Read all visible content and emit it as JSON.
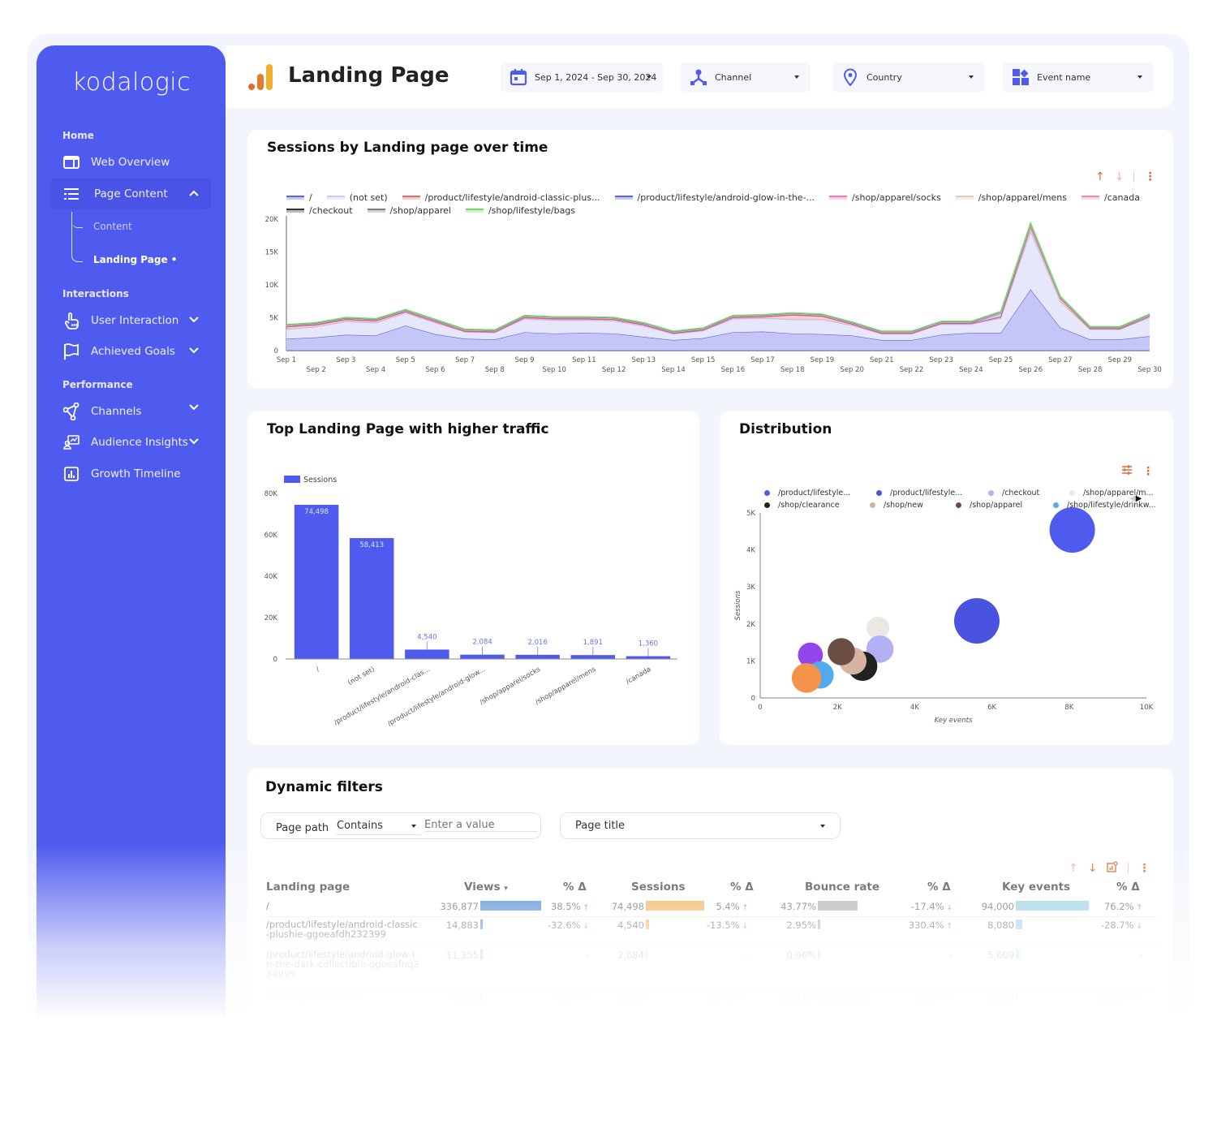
{
  "sidebar": {
    "logo": "kodalogic",
    "sections": [
      {
        "label": "Home"
      },
      {
        "label": "Interactions"
      },
      {
        "label": "Performance"
      }
    ],
    "items": [
      {
        "label": "Web Overview",
        "icon": "browser-window-icon"
      },
      {
        "label": "Page Content",
        "icon": "list-icon",
        "expanded": true
      },
      {
        "label": "User Interaction",
        "icon": "hand-pointer-icon"
      },
      {
        "label": "Achieved Goals",
        "icon": "flag-icon"
      },
      {
        "label": "Channels",
        "icon": "share-nodes-icon"
      },
      {
        "label": "Audience Insights",
        "icon": "audience-icon"
      },
      {
        "label": "Growth Timeline",
        "icon": "bar-chart-icon"
      }
    ],
    "subitems": [
      {
        "label": "Content"
      },
      {
        "label": "Landing Page •",
        "current": true
      }
    ]
  },
  "header": {
    "title": "Landing Page",
    "filters": [
      {
        "label": "Sep 1, 2024 - Sep 30, 2024",
        "icon": "calendar-icon"
      },
      {
        "label": "Channel",
        "icon": "channel-icon"
      },
      {
        "label": "Country",
        "icon": "location-pin-icon"
      },
      {
        "label": "Event name",
        "icon": "widgets-icon"
      }
    ]
  },
  "colors": {
    "brand": "#4f5bef",
    "accent_orange": "#d96b35",
    "bar": "#4f5bef",
    "views_bar": "#3d7ecb",
    "sessions_bar": "#f2a94a",
    "bounce_bar": "#a9a9a9",
    "key_events_bar": "#8fcbe0"
  },
  "chart_data": [
    {
      "type": "area",
      "title": "Sessions by Landing page over time",
      "stacked": true,
      "xlabel": "",
      "ylabel": "",
      "ylim": [
        0,
        20000
      ],
      "yticks": [
        "0",
        "5K",
        "10K",
        "15K",
        "20K"
      ],
      "x": [
        "Sep 1",
        "Sep 2",
        "Sep 3",
        "Sep 4",
        "Sep 5",
        "Sep 6",
        "Sep 7",
        "Sep 8",
        "Sep 9",
        "Sep 10",
        "Sep 11",
        "Sep 12",
        "Sep 13",
        "Sep 14",
        "Sep 15",
        "Sep 16",
        "Sep 17",
        "Sep 18",
        "Sep 19",
        "Sep 20",
        "Sep 21",
        "Sep 22",
        "Sep 23",
        "Sep 24",
        "Sep 25",
        "Sep 26",
        "Sep 27",
        "Sep 28",
        "Sep 29",
        "Sep 30"
      ],
      "legend_position": "top",
      "series": [
        {
          "name": "/",
          "color": "#5b63e8",
          "values": [
            1800,
            2000,
            2400,
            2300,
            3800,
            2500,
            1800,
            1700,
            2800,
            2600,
            2700,
            2600,
            2100,
            1600,
            1900,
            2800,
            2900,
            2600,
            2500,
            2300,
            1600,
            1600,
            2400,
            2700,
            2700,
            9300,
            3500,
            1700,
            1700,
            2200
          ]
        },
        {
          "name": "(not set)",
          "color": "#c8cbf7",
          "values": [
            1400,
            1600,
            2000,
            1900,
            1900,
            1700,
            1000,
            1000,
            2000,
            2000,
            1900,
            1900,
            1600,
            900,
            1100,
            2000,
            2000,
            2100,
            2200,
            1500,
            900,
            900,
            1600,
            1300,
            2200,
            8800,
            3900,
            1500,
            1500,
            2800
          ]
        },
        {
          "name": "/product/lifestyle/android-classic-plus...",
          "color": "#ee6b6b",
          "values": [
            400,
            300,
            300,
            300,
            200,
            200,
            100,
            100,
            200,
            200,
            200,
            200,
            200,
            100,
            100,
            200,
            200,
            700,
            500,
            200,
            100,
            100,
            100,
            100,
            200,
            700,
            500,
            100,
            100,
            200
          ]
        },
        {
          "name": "/product/lifestyle/android-glow-in-the-...",
          "color": "#5b63e8",
          "values": [
            100,
            100,
            100,
            100,
            100,
            100,
            100,
            100,
            100,
            100,
            100,
            100,
            100,
            100,
            100,
            100,
            100,
            100,
            100,
            100,
            100,
            100,
            100,
            100,
            600,
            100,
            100,
            100,
            100,
            100
          ]
        },
        {
          "name": "/shop/apparel/socks",
          "color": "#f07ac0",
          "values": [
            50,
            50,
            50,
            50,
            50,
            50,
            50,
            50,
            50,
            50,
            50,
            50,
            50,
            50,
            50,
            50,
            50,
            50,
            50,
            50,
            50,
            50,
            50,
            50,
            50,
            100,
            50,
            50,
            50,
            50
          ]
        },
        {
          "name": "/shop/apparel/mens",
          "color": "#e8c8b8",
          "values": [
            50,
            50,
            50,
            50,
            50,
            50,
            50,
            50,
            50,
            50,
            50,
            50,
            50,
            50,
            50,
            50,
            50,
            50,
            50,
            50,
            50,
            50,
            50,
            50,
            50,
            100,
            50,
            50,
            50,
            50
          ]
        },
        {
          "name": "/canada",
          "color": "#f08cab",
          "values": [
            50,
            50,
            50,
            50,
            50,
            50,
            50,
            50,
            50,
            50,
            50,
            50,
            50,
            50,
            50,
            50,
            50,
            50,
            50,
            50,
            50,
            50,
            50,
            50,
            50,
            100,
            50,
            50,
            50,
            50
          ]
        },
        {
          "name": "/checkout",
          "color": "#333333",
          "values": [
            50,
            50,
            50,
            50,
            50,
            50,
            50,
            50,
            50,
            50,
            50,
            50,
            50,
            50,
            50,
            50,
            50,
            50,
            50,
            50,
            50,
            50,
            50,
            50,
            50,
            100,
            50,
            50,
            50,
            50
          ]
        },
        {
          "name": "/shop/apparel",
          "color": "#8a7a75",
          "values": [
            20,
            20,
            20,
            20,
            20,
            20,
            20,
            20,
            20,
            20,
            20,
            20,
            20,
            20,
            20,
            20,
            20,
            20,
            20,
            20,
            20,
            20,
            20,
            20,
            20,
            50,
            20,
            20,
            20,
            20
          ]
        },
        {
          "name": "/shop/lifestyle/bags",
          "color": "#6fdd6f",
          "values": [
            30,
            30,
            30,
            30,
            30,
            30,
            30,
            30,
            30,
            30,
            30,
            30,
            30,
            30,
            30,
            30,
            30,
            30,
            30,
            30,
            30,
            30,
            30,
            30,
            30,
            50,
            30,
            30,
            30,
            30
          ]
        }
      ]
    },
    {
      "type": "bar",
      "title": "Top Landing Page with higher traffic",
      "categories": [
        "/",
        "(not set)",
        "/product/lifestyle/android-clas...",
        "/product/lifestyle/android-glow...",
        "/shop/apparel/socks",
        "/shop/apparel/mens",
        "/canada"
      ],
      "values": [
        74498,
        58413,
        4540,
        2084,
        2016,
        1891,
        1360
      ],
      "labels": [
        "74,498",
        "58,413",
        "4,540",
        "2,084",
        "2,016",
        "1,891",
        "1,360"
      ],
      "legend": [
        "Sessions"
      ],
      "legend_position": "top-left",
      "ylim": [
        0,
        80000
      ],
      "yticks": [
        "0",
        "20K",
        "40K",
        "60K",
        "80K"
      ],
      "xlabel": "",
      "ylabel": ""
    },
    {
      "type": "scatter",
      "title": "Distribution",
      "xlabel": "Key events",
      "ylabel": "Sessions",
      "xlim": [
        0,
        10000
      ],
      "ylim": [
        0,
        5000
      ],
      "xticks": [
        "0",
        "2K",
        "4K",
        "6K",
        "8K",
        "10K"
      ],
      "yticks": [
        "0",
        "1K",
        "2K",
        "3K",
        "4K",
        "5K"
      ],
      "legend_position": "top",
      "series": [
        {
          "name": "/product/lifestyle...",
          "color": "#4f5bef",
          "x": 8080,
          "y": 4540,
          "size": 1.0
        },
        {
          "name": "/product/lifestyle...",
          "color": "#4a52e0",
          "x": 5609,
          "y": 2084,
          "size": 1.0
        },
        {
          "name": "/checkout",
          "color": "#b3b1f5",
          "x": 3100,
          "y": 1320,
          "size": 0.6
        },
        {
          "name": "/shop/apparel/m...",
          "color": "#ebe8e4",
          "x": 3050,
          "y": 1891,
          "size": 0.5
        },
        {
          "name": "/shop/clearance",
          "color": "#222222",
          "x": 2650,
          "y": 860,
          "size": 0.65
        },
        {
          "name": "/shop/new",
          "color": "#d7b3a1",
          "x": 2400,
          "y": 1000,
          "size": 0.6
        },
        {
          "name": "/shop/apparel",
          "color": "#6b4f44",
          "x": 2100,
          "y": 1250,
          "size": 0.6
        },
        {
          "name": "/shop/lifestyle/drinkw...",
          "color": "#53a9f0",
          "x": 1550,
          "y": 620,
          "size": 0.6
        },
        {
          "name": "",
          "color": "#9346ea",
          "x": 1300,
          "y": 1160,
          "size": 0.55
        },
        {
          "name": "",
          "color": "#f4934a",
          "x": 1200,
          "y": 540,
          "size": 0.65
        }
      ]
    }
  ],
  "dynamic_filters": {
    "title": "Dynamic filters",
    "page_path_label": "Page path",
    "operator": "Contains",
    "value_placeholder": "Enter a value",
    "page_title_label": "Page title"
  },
  "table": {
    "headers": [
      "Landing page",
      "Views",
      "% Δ",
      "Sessions",
      "% Δ",
      "Bounce rate",
      "% Δ",
      "Key events",
      "% Δ"
    ],
    "sort_indicator": "▾",
    "rows": [
      {
        "page": "/",
        "views": "336,877",
        "views_frac": 1.0,
        "views_d": "38.5%",
        "views_dir": "up",
        "sessions": "74,498",
        "sessions_frac": 1.0,
        "sessions_d": "5.4%",
        "sessions_dir": "up",
        "bounce": "43.77%",
        "bounce_frac": 0.82,
        "bounce_d": "-17.4%",
        "bounce_dir": "down",
        "key": "94,000",
        "key_frac": 1.0,
        "key_d": "76.2%",
        "key_dir": "up"
      },
      {
        "page": "/product/lifestyle/android-classic-plushie-ggoeafdh232399",
        "views": "14,883",
        "views_frac": 0.044,
        "views_d": "-32.6%",
        "views_dir": "down",
        "sessions": "4,540",
        "sessions_frac": 0.061,
        "sessions_d": "-13.5%",
        "sessions_dir": "down",
        "bounce": "2.95%",
        "bounce_frac": 0.055,
        "bounce_d": "330.4%",
        "bounce_dir": "up",
        "key": "8,080",
        "key_frac": 0.086,
        "key_d": "-28.7%",
        "key_dir": "down"
      },
      {
        "page": "/product/lifestyle/android-glow-in-the-dark-collectible-ggoeafnq234999",
        "views": "11,355",
        "views_frac": 0.034,
        "views_d": "-",
        "views_dir": "",
        "sessions": "2,084",
        "sessions_frac": 0.028,
        "sessions_d": "-",
        "sessions_dir": "",
        "bounce": "0.96%",
        "bounce_frac": 0.018,
        "bounce_d": "-",
        "bounce_dir": "",
        "key": "5,609",
        "key_frac": 0.06,
        "key_d": "-",
        "key_dir": ""
      },
      {
        "page": "/shop/apparel/mens",
        "views": "8,518",
        "views_frac": 0.025,
        "views_d": "78.0%",
        "views_dir": "up",
        "sessions": "1,891",
        "sessions_frac": 0.025,
        "sessions_d": "59.8%",
        "sessions_dir": "up",
        "bounce": "53.31%",
        "bounce_frac": 1.0,
        "bounce_d": "22.0%",
        "bounce_dir": "up",
        "key": "3,050",
        "key_frac": 0.032,
        "key_d": "111.8%",
        "key_dir": "up"
      }
    ]
  }
}
